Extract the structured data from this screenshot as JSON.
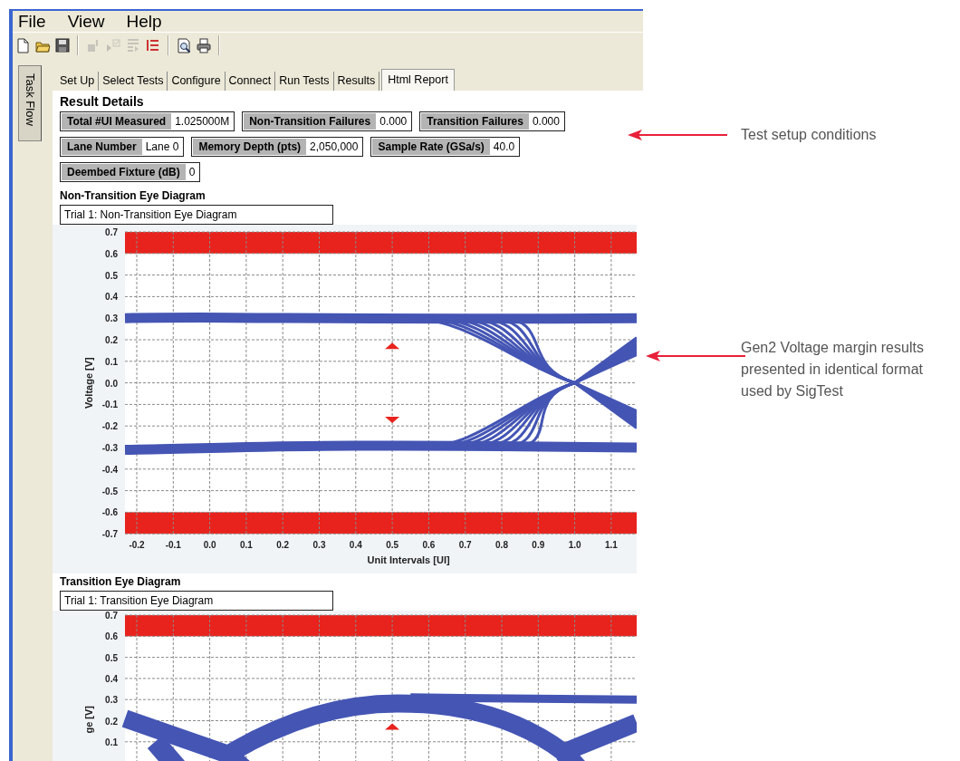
{
  "menu": [
    "File",
    "View",
    "Help"
  ],
  "toolbar": [
    {
      "kind": "new",
      "disabled": false
    },
    {
      "kind": "open",
      "disabled": false
    },
    {
      "kind": "save",
      "disabled": false
    },
    {
      "kind": "separator"
    },
    {
      "kind": "run",
      "disabled": true
    },
    {
      "kind": "check",
      "disabled": true
    },
    {
      "kind": "steps",
      "disabled": true
    },
    {
      "kind": "list",
      "disabled": false
    },
    {
      "kind": "separator"
    },
    {
      "kind": "preview",
      "disabled": false
    },
    {
      "kind": "print",
      "disabled": false
    },
    {
      "kind": "separator"
    }
  ],
  "side_tab": {
    "label": "Task Flow"
  },
  "tabs": [
    {
      "label": "Set Up",
      "selected": false
    },
    {
      "label": "Select Tests",
      "selected": false
    },
    {
      "label": "Configure",
      "selected": false
    },
    {
      "label": "Connect",
      "selected": false
    },
    {
      "label": "Run Tests",
      "selected": false
    },
    {
      "label": "Results",
      "selected": false
    },
    {
      "label": "Html Report",
      "selected": true
    }
  ],
  "heading": "Result Details",
  "field_rows": [
    [
      {
        "label": "Total #UI Measured",
        "value": "1.025000M"
      },
      {
        "label": "Non-Transition Failures",
        "value": "0.000"
      },
      {
        "label": "Transition Failures",
        "value": "0.000"
      }
    ],
    [
      {
        "label": "Lane Number",
        "value": "Lane 0"
      },
      {
        "label": "Memory Depth (pts)",
        "value": "2,050,000"
      },
      {
        "label": "Sample Rate (GSa/s)",
        "value": "40.0"
      }
    ],
    [
      {
        "label": "Deembed Fixture (dB)",
        "value": "0"
      }
    ]
  ],
  "charts": [
    {
      "title": "Non-Transition Eye Diagram",
      "trial": "Trial 1: Non-Transition Eye Diagram",
      "kind": "non_transition",
      "ylabel": "Voltage [V]",
      "xlabel": "Unit Intervals [UI]",
      "y_ticks": [
        "0.7",
        "0.6",
        "0.5",
        "0.4",
        "0.3",
        "0.2",
        "0.1",
        "0.0",
        "-0.1",
        "-0.2",
        "-0.3",
        "-0.4",
        "-0.5",
        "-0.6",
        "-0.7"
      ],
      "x_ticks": [
        "-0.2",
        "-0.1",
        "0.0",
        "0.1",
        "0.2",
        "0.3",
        "0.4",
        "0.5",
        "0.6",
        "0.7",
        "0.8",
        "0.9",
        "1.0",
        "1.1"
      ]
    },
    {
      "title": "Transition Eye Diagram",
      "trial": "Trial 1: Transition Eye Diagram",
      "kind": "transition",
      "ylabel": "ge [V]",
      "y_ticks": [
        "0.7",
        "0.6",
        "0.5",
        "0.4",
        "0.3",
        "0.2",
        "0.1"
      ]
    }
  ],
  "callouts": [
    {
      "text": "Test setup conditions"
    },
    {
      "text": "Gen2 Voltage margin results\npresented in identical format\nused by SigTest"
    }
  ]
}
